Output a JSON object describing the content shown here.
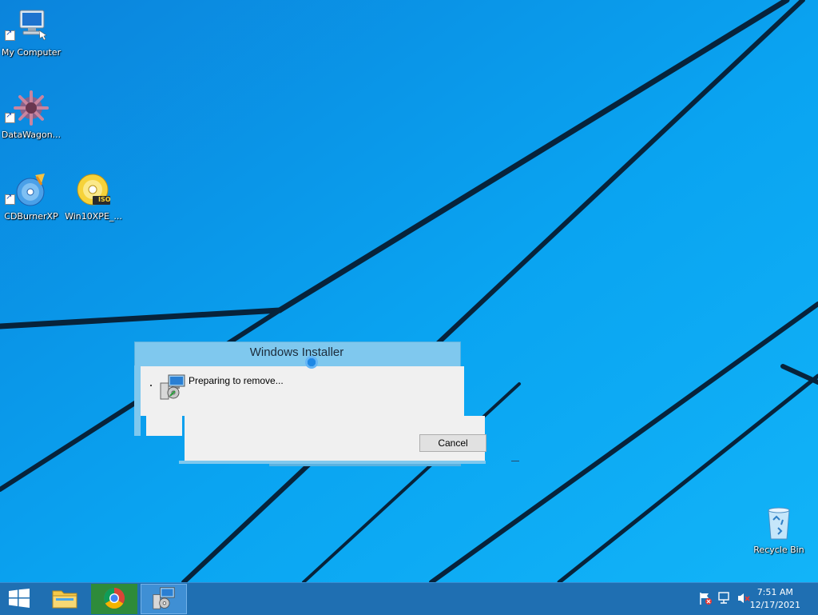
{
  "desktop": {
    "icons": [
      {
        "label": "My Computer",
        "icon": "computer-icon"
      },
      {
        "label": "DataWagon...",
        "icon": "gear-cluster-icon"
      },
      {
        "label": "CDBurnerXP",
        "icon": "cd-burner-icon"
      },
      {
        "label": "Win10XPE_...",
        "icon": "iso-disc-icon",
        "badge": "ISO"
      },
      {
        "label": "Recycle Bin",
        "icon": "recycle-bin-icon"
      }
    ]
  },
  "dialog": {
    "title": "Windows Installer",
    "message": "Preparing to remove...",
    "cancel_label": "Cancel"
  },
  "taskbar": {
    "apps": [
      {
        "name": "File Explorer",
        "icon": "folder-icon"
      },
      {
        "name": "Google Chrome",
        "icon": "chrome-icon"
      },
      {
        "name": "Windows Installer",
        "icon": "installer-icon",
        "active": true
      }
    ],
    "tray": [
      "action-center-flag-icon",
      "network-icon",
      "volume-muted-icon"
    ],
    "time": "7:51 AM",
    "date": "12/17/2021"
  },
  "colors": {
    "wallpaper": "#0aa2f0",
    "taskbar": "#1f6fb2",
    "dialog_frame": "#7fc8ee",
    "dialog_body": "#f0f0f0"
  }
}
